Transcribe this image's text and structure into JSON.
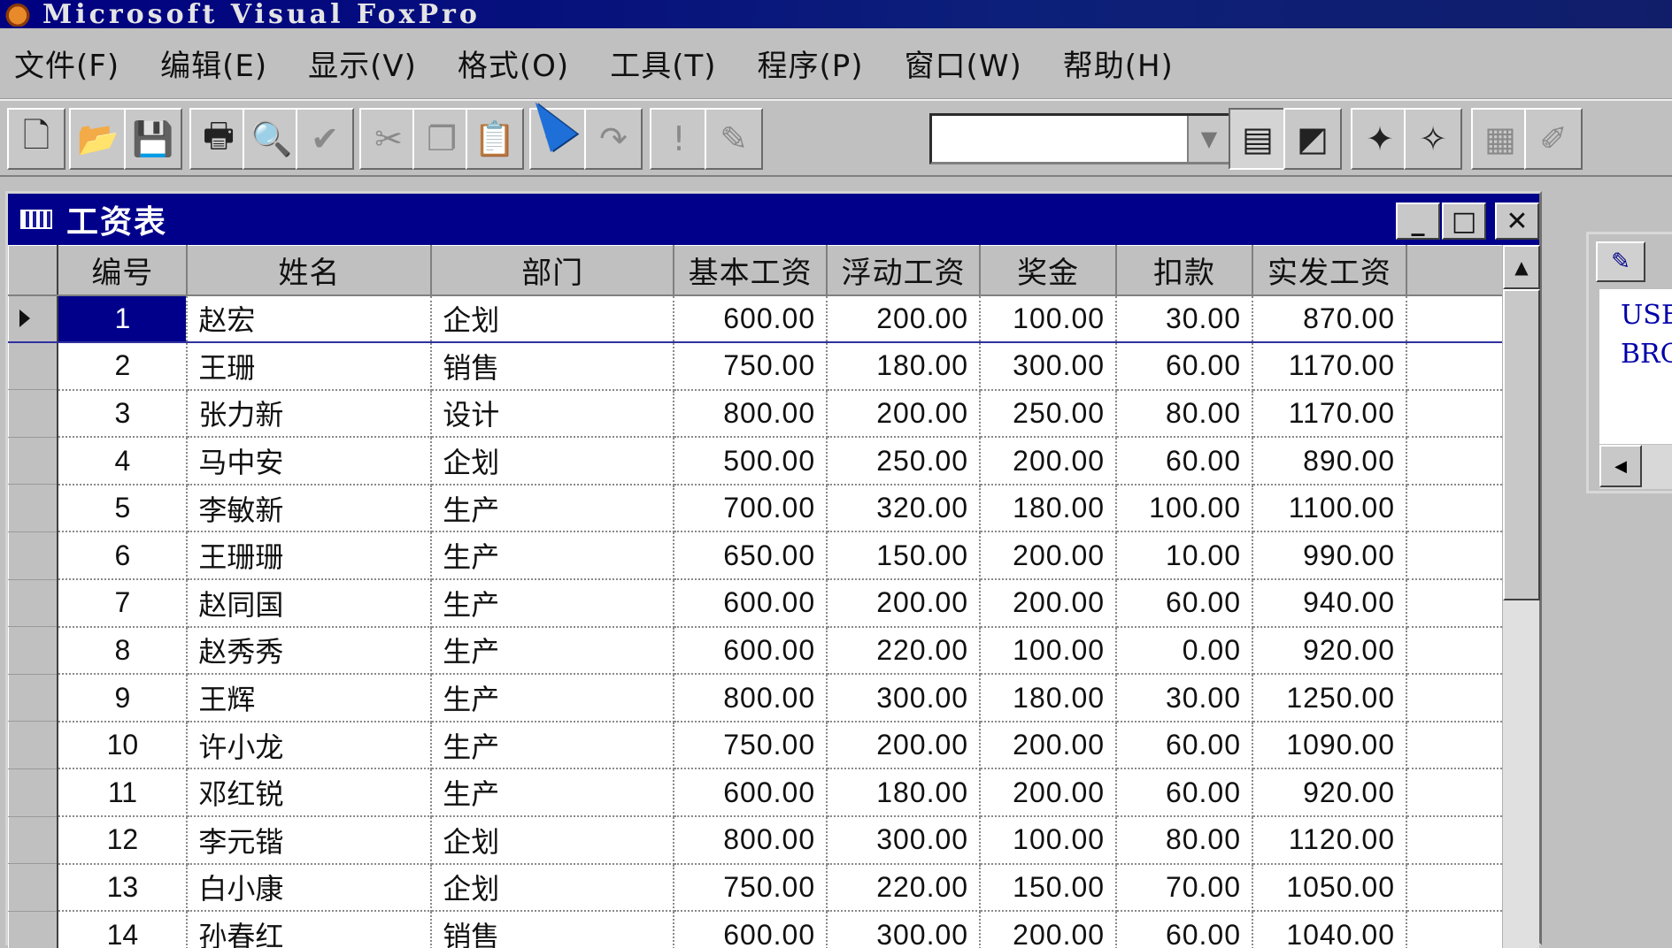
{
  "app": {
    "title": "Microsoft Visual FoxPro"
  },
  "menu": [
    "文件(F)",
    "编辑(E)",
    "显示(V)",
    "格式(O)",
    "工具(T)",
    "程序(P)",
    "窗口(W)",
    "帮助(H)"
  ],
  "toolbar": {
    "buttons": [
      {
        "icon": "new-icon",
        "glyph": "🗋",
        "enabled": true
      },
      {
        "icon": "open-icon",
        "glyph": "📂",
        "enabled": true
      },
      {
        "icon": "save-icon",
        "glyph": "💾",
        "enabled": false
      },
      {
        "icon": "print-icon",
        "glyph": "🖶",
        "enabled": true
      },
      {
        "icon": "print-preview-icon",
        "glyph": "🔍",
        "enabled": false
      },
      {
        "icon": "spell-check-icon",
        "glyph": "✔",
        "enabled": false
      },
      {
        "icon": "cut-icon",
        "glyph": "✂",
        "enabled": false
      },
      {
        "icon": "copy-icon",
        "glyph": "❐",
        "enabled": false
      },
      {
        "icon": "paste-icon",
        "glyph": "📋",
        "enabled": false
      },
      {
        "icon": "undo-icon",
        "glyph": "↶",
        "enabled": false
      },
      {
        "icon": "redo-icon",
        "glyph": "↷",
        "enabled": false
      },
      {
        "icon": "run-icon",
        "glyph": "!",
        "enabled": false
      },
      {
        "icon": "modify-form-icon",
        "glyph": "✎",
        "enabled": false
      },
      {
        "icon": "command-window-icon",
        "glyph": "▤",
        "enabled": true
      },
      {
        "icon": "view-window-icon",
        "glyph": "◩",
        "enabled": true
      },
      {
        "icon": "form-wizard-icon",
        "glyph": "✦",
        "enabled": true
      },
      {
        "icon": "report-wizard-icon",
        "glyph": "✧",
        "enabled": true
      },
      {
        "icon": "autoform-icon",
        "glyph": "▦",
        "enabled": false
      },
      {
        "icon": "autoreport-icon",
        "glyph": "✐",
        "enabled": false
      }
    ],
    "combo_value": ""
  },
  "browse": {
    "title": "工资表",
    "columns": [
      "编号",
      "姓名",
      "部门",
      "基本工资",
      "浮动工资",
      "奖金",
      "扣款",
      "实发工资"
    ],
    "rows": [
      [
        "1",
        "赵宏",
        "企划",
        "600.00",
        "200.00",
        "100.00",
        "30.00",
        "870.00"
      ],
      [
        "2",
        "王珊",
        "销售",
        "750.00",
        "180.00",
        "300.00",
        "60.00",
        "1170.00"
      ],
      [
        "3",
        "张力新",
        "设计",
        "800.00",
        "200.00",
        "250.00",
        "80.00",
        "1170.00"
      ],
      [
        "4",
        "马中安",
        "企划",
        "500.00",
        "250.00",
        "200.00",
        "60.00",
        "890.00"
      ],
      [
        "5",
        "李敏新",
        "生产",
        "700.00",
        "320.00",
        "180.00",
        "100.00",
        "1100.00"
      ],
      [
        "6",
        "王珊珊",
        "生产",
        "650.00",
        "150.00",
        "200.00",
        "10.00",
        "990.00"
      ],
      [
        "7",
        "赵同国",
        "生产",
        "600.00",
        "200.00",
        "200.00",
        "60.00",
        "940.00"
      ],
      [
        "8",
        "赵秀秀",
        "生产",
        "600.00",
        "220.00",
        "100.00",
        "0.00",
        "920.00"
      ],
      [
        "9",
        "王辉",
        "生产",
        "800.00",
        "300.00",
        "180.00",
        "30.00",
        "1250.00"
      ],
      [
        "10",
        "许小龙",
        "生产",
        "750.00",
        "200.00",
        "200.00",
        "60.00",
        "1090.00"
      ],
      [
        "11",
        "邓红锐",
        "生产",
        "600.00",
        "180.00",
        "200.00",
        "60.00",
        "920.00"
      ],
      [
        "12",
        "李元锴",
        "企划",
        "800.00",
        "300.00",
        "100.00",
        "80.00",
        "1120.00"
      ],
      [
        "13",
        "白小康",
        "企划",
        "750.00",
        "220.00",
        "150.00",
        "70.00",
        "1050.00"
      ],
      [
        "14",
        "孙春红",
        "销售",
        "600.00",
        "300.00",
        "200.00",
        "60.00",
        "1040.00"
      ]
    ],
    "current_row": 0
  },
  "command_window": {
    "lines": [
      "USE",
      "BROW"
    ]
  },
  "colors": {
    "title_bar": "#00008a",
    "selection": "#00008a",
    "face": "#c0c0c0"
  }
}
